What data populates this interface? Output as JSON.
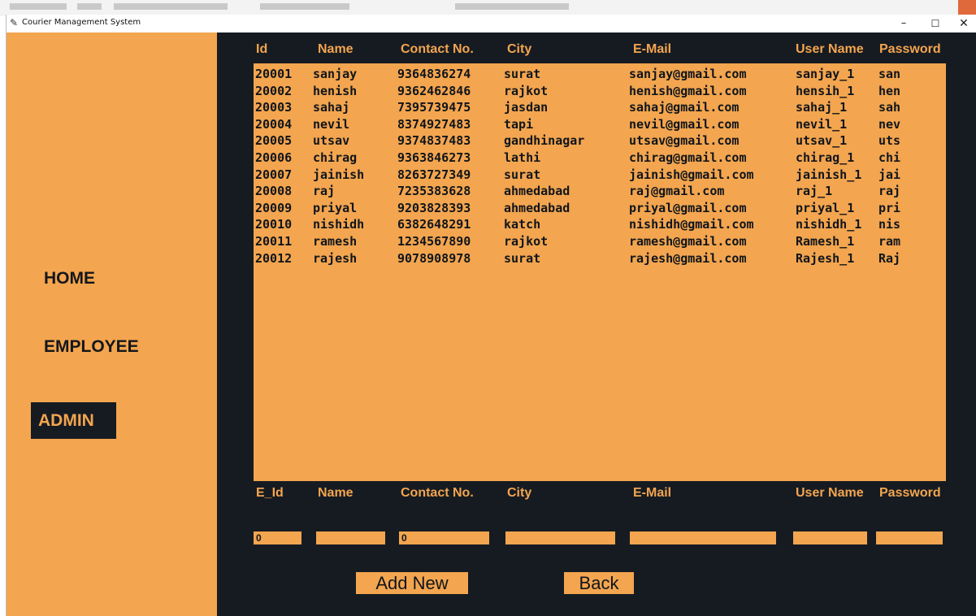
{
  "window": {
    "title": "Courier Management System",
    "controls": {
      "minimize": "–",
      "maximize": "☐",
      "close": "✕"
    }
  },
  "sidebar": {
    "items": [
      {
        "label": "HOME",
        "active": false
      },
      {
        "label": "EMPLOYEE",
        "active": false
      },
      {
        "label": "ADMIN",
        "active": true
      }
    ]
  },
  "table": {
    "headers": [
      "Id",
      "Name",
      "Contact No.",
      "City",
      "E-Mail",
      "User Name",
      "Password"
    ],
    "rows": [
      [
        "20001",
        "sanjay",
        "9364836274",
        "surat",
        "sanjay@gmail.com",
        "sanjay_1",
        "san"
      ],
      [
        "20002",
        "henish",
        "9362462846",
        "rajkot",
        "henish@gmail.com",
        "hensih_1",
        "hen"
      ],
      [
        "20003",
        "sahaj",
        "7395739475",
        "jasdan",
        "sahaj@gmail.com",
        "sahaj_1",
        "sah"
      ],
      [
        "20004",
        "nevil",
        "8374927483",
        "tapi",
        "nevil@gmail.com",
        "nevil_1",
        "nev"
      ],
      [
        "20005",
        "utsav",
        "9374837483",
        "gandhinagar",
        "utsav@gmail.com",
        "utsav_1",
        "uts"
      ],
      [
        "20006",
        "chirag",
        "9363846273",
        "lathi",
        "chirag@gmail.com",
        "chirag_1",
        "chi"
      ],
      [
        "20007",
        "jainish",
        "8263727349",
        "surat",
        "jainish@gmail.com",
        "jainish_1",
        "jai"
      ],
      [
        "20008",
        "raj",
        "7235383628",
        "ahmedabad",
        "raj@gmail.com",
        "raj_1",
        "raj"
      ],
      [
        "20009",
        "priyal",
        "9203828393",
        "ahmedabad",
        "priyal@gmail.com",
        "priyal_1",
        "pri"
      ],
      [
        "20010",
        "nishidh",
        "6382648291",
        "katch",
        "nishidh@gmail.com",
        "nishidh_1",
        "nis"
      ],
      [
        "20011",
        "ramesh",
        "1234567890",
        "rajkot",
        "ramesh@gmail.com",
        "Ramesh_1",
        "ram"
      ],
      [
        "20012",
        "rajesh",
        "9078908978",
        "surat",
        "rajesh@gmail.com",
        "Rajesh_1",
        "Raj"
      ]
    ]
  },
  "form": {
    "labels": [
      "E_Id",
      "Name",
      "Contact No.",
      "City",
      "E-Mail",
      "User Name",
      "Password"
    ],
    "values": [
      "0",
      "",
      "0",
      "",
      "",
      "",
      ""
    ]
  },
  "buttons": {
    "add_new": "Add New",
    "back": "Back"
  },
  "colors": {
    "accent": "#f3a54f",
    "dark": "#161b22"
  }
}
